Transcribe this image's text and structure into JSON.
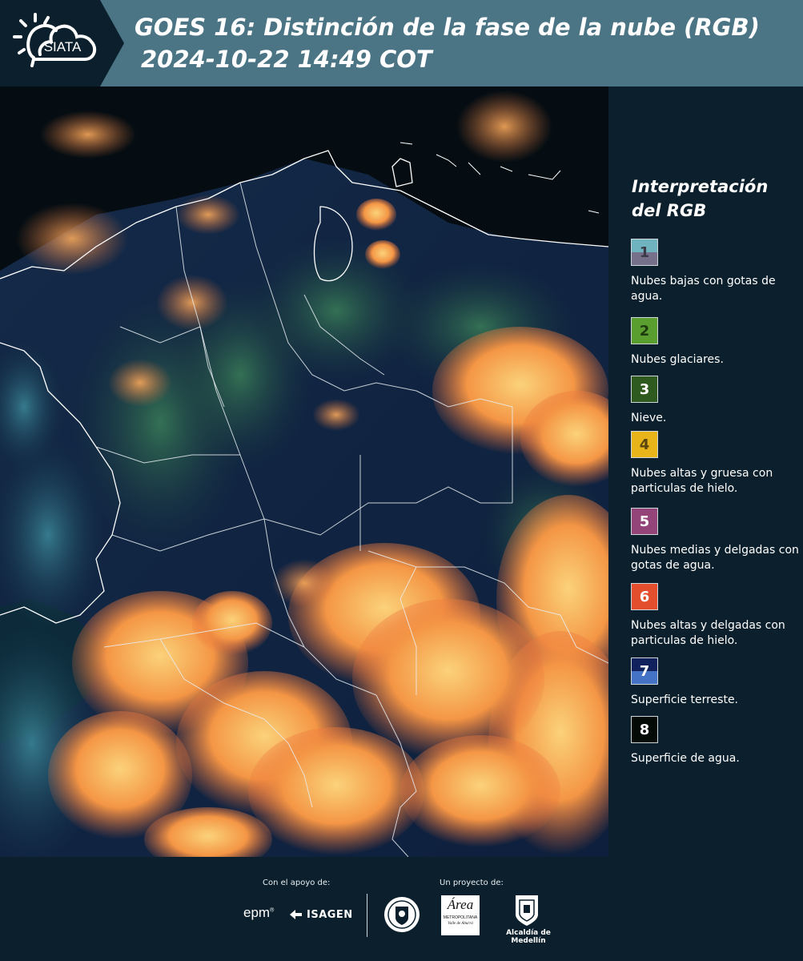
{
  "header": {
    "logo_text": "SIATA",
    "title_line1": "GOES 16: Distinción de la fase de la nube (RGB)",
    "title_line2": "2024-10-22 14:49 COT"
  },
  "legend": {
    "title": "Interpretación del RGB",
    "items": [
      {
        "number": "1",
        "label": "Nubes bajas con gotas de agua.",
        "color_top": "#6fb3bf",
        "color_bottom": "#77708a"
      },
      {
        "number": "2",
        "label": "Nubes glaciares.",
        "color_top": "#5a9e2f",
        "color_bottom": "#5a9e2f"
      },
      {
        "number": "3",
        "label": "Nieve.",
        "color_top": "#2f5a1f",
        "color_bottom": "#2f5a1f"
      },
      {
        "number": "4",
        "label": "Nubes altas y gruesa con particulas de hielo.",
        "color_top": "#e7b51a",
        "color_bottom": "#e7b51a"
      },
      {
        "number": "5",
        "label": "Nubes medias y delgadas con gotas de agua.",
        "color_top": "#93457a",
        "color_bottom": "#93457a"
      },
      {
        "number": "6",
        "label": "Nubes altas y delgadas con particulas de hielo.",
        "color_top": "#e34f2c",
        "color_bottom": "#e34f2c"
      },
      {
        "number": "7",
        "label": "Superficie terreste.",
        "color_top": "#10215e",
        "color_bottom": "#4472c4"
      },
      {
        "number": "8",
        "label": "Superficie de agua.",
        "color_top": "#040b06",
        "color_bottom": "#040b06"
      }
    ]
  },
  "footer": {
    "support_caption": "Con el apoyo de:",
    "project_caption": "Un proyecto de:",
    "sponsor_epm": "epm",
    "sponsor_isagen": "ISAGEN",
    "area_name": "Área",
    "area_subtitle": "METROPOLITANA",
    "area_subtitle2": "Valle de Aburrá",
    "alcaldia": "Alcaldía de Medellín"
  },
  "colors": {
    "header_band": "#4b7585",
    "panel": "#0b1f2c",
    "cloud_orange": "#f08a3c",
    "cloud_yellow": "#f5c35c",
    "border_lines": "#ffffff"
  }
}
